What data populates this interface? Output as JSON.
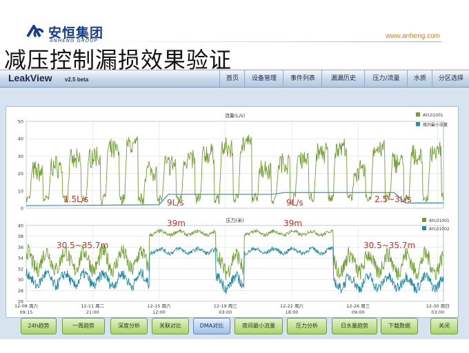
{
  "slide": {
    "logo_cn": "安恒集团",
    "logo_en": "ANHENG GROUP",
    "url": "www.anheng.com",
    "title": "减压控制漏损效果验证"
  },
  "app": {
    "name": "LeakView",
    "version": "v2.5 beta",
    "nav": [
      "首页",
      "设备管理",
      "事件列表",
      "漏漏历史",
      "压力/流量",
      "水质",
      "分区选择"
    ]
  },
  "buttons": [
    "24h趋势",
    "一周趋势",
    "深度分析",
    "关联对比",
    "DMA对比",
    "夜间最小流量",
    "压力分析",
    "日水量趋势",
    "下载数据",
    "关闭"
  ],
  "active_button": "DMA对比",
  "annotations": {
    "flow": [
      "1.5L/s",
      "9L/s",
      "9L/s",
      "2.5~3L/s"
    ],
    "pressure_high": [
      "39m",
      "39m"
    ],
    "pressure_low": [
      "30.5~35.7m",
      "30.5~35.7m"
    ]
  },
  "chart_data": [
    {
      "type": "line",
      "title": "流量(L/s)",
      "y_ticks": [
        "50",
        "40",
        "30",
        "20",
        "10",
        "0"
      ],
      "ylim": [
        0,
        50
      ],
      "xlim_days": [
        0,
        22
      ],
      "grid": true,
      "legend_position": "top-right",
      "series": [
        {
          "name": "AYL01001",
          "color": "#6f9f2e",
          "description": "daily cycle, night min ~5, day peaks 25-42 L/s"
        },
        {
          "name": "夜间最小流量",
          "color": "#2a8fb0",
          "step_x": [
            0,
            0.7,
            7,
            7.5,
            13,
            13.6,
            19.4,
            20,
            22
          ],
          "step_y": [
            1.5,
            1.5,
            2,
            8,
            8,
            9,
            9,
            3,
            3
          ]
        }
      ]
    },
    {
      "type": "line",
      "title": "压力(米)",
      "y_ticks": [
        "40",
        "38",
        "36",
        "34",
        "32",
        "30",
        "28",
        "26"
      ],
      "ylim": [
        26,
        40
      ],
      "xlim_days": [
        0,
        22
      ],
      "grid": true,
      "legend_position": "top-right",
      "x_ticks": [
        {
          "x": 0,
          "l1": "12-08 周六",
          "l2": "09:15"
        },
        {
          "x": 3.5,
          "l1": "12-11 周二",
          "l2": "21:00"
        },
        {
          "x": 7,
          "l1": "12-15 周六",
          "l2": "12:00"
        },
        {
          "x": 10.5,
          "l1": "12-19 周三",
          "l2": "03:00"
        },
        {
          "x": 14,
          "l1": "12-22 周六",
          "l2": "18:00"
        },
        {
          "x": 17.5,
          "l1": "12-26 周三",
          "l2": "09:00"
        },
        {
          "x": 21.7,
          "l1": "12-30 周日",
          "l2": "03:00"
        }
      ],
      "series": [
        {
          "name": "AYL01001",
          "color": "#6f9f2e",
          "segments": [
            {
              "x0": 0,
              "x1": 6.5,
              "mean": 33.5,
              "amp": 2.8
            },
            {
              "x0": 6.5,
              "x1": 10,
              "mean": 38.6,
              "amp": 0.6
            },
            {
              "x0": 10,
              "x1": 11.5,
              "mean": 33,
              "amp": 2.8
            },
            {
              "x0": 11.5,
              "x1": 16.2,
              "mean": 38.6,
              "amp": 0.6
            },
            {
              "x0": 16.2,
              "x1": 22,
              "mean": 33,
              "amp": 2.8
            }
          ]
        },
        {
          "name": "AYL01002",
          "color": "#1f8aa8",
          "segments": [
            {
              "x0": 0,
              "x1": 6.5,
              "mean": 30,
              "amp": 1.8
            },
            {
              "x0": 6.5,
              "x1": 10,
              "mean": 35.3,
              "amp": 0.7
            },
            {
              "x0": 10,
              "x1": 11.5,
              "mean": 29.5,
              "amp": 1.8
            },
            {
              "x0": 11.5,
              "x1": 16.2,
              "mean": 35.3,
              "amp": 0.7
            },
            {
              "x0": 16.2,
              "x1": 22,
              "mean": 29.5,
              "amp": 1.8
            }
          ]
        }
      ]
    }
  ]
}
